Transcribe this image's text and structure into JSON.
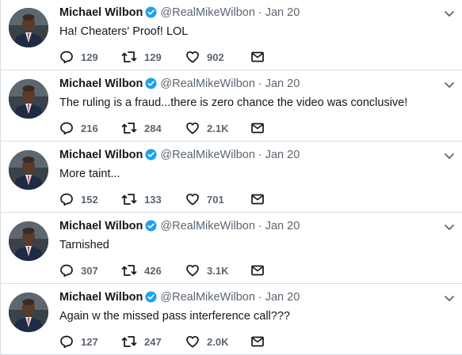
{
  "account": {
    "name": "Michael Wilbon",
    "handle": "@RealMikeWilbon",
    "verified": true
  },
  "icons": {
    "reply": "reply-icon",
    "retweet": "retweet-icon",
    "like": "like-icon",
    "dm": "direct-message-icon",
    "verified": "verified-badge-icon",
    "caret": "chevron-down-icon"
  },
  "colors": {
    "text": "#14171a",
    "muted": "#5b6670",
    "verified": "#1da1f2",
    "divider": "#d9dde1"
  },
  "tweets": [
    {
      "date": "Jan 20",
      "text": "Ha! Cheaters' Proof! LOL",
      "replies": "129",
      "retweets": "129",
      "likes": "902"
    },
    {
      "date": "Jan 20",
      "text": "The ruling is a fraud...there is zero chance the video was conclusive!",
      "replies": "216",
      "retweets": "284",
      "likes": "2.1K"
    },
    {
      "date": "Jan 20",
      "text": "More taint...",
      "replies": "152",
      "retweets": "133",
      "likes": "701"
    },
    {
      "date": "Jan 20",
      "text": "Tarnished",
      "replies": "307",
      "retweets": "426",
      "likes": "3.1K"
    },
    {
      "date": "Jan 20",
      "text": "Again w the missed pass interference call???",
      "replies": "127",
      "retweets": "247",
      "likes": "2.0K"
    }
  ]
}
